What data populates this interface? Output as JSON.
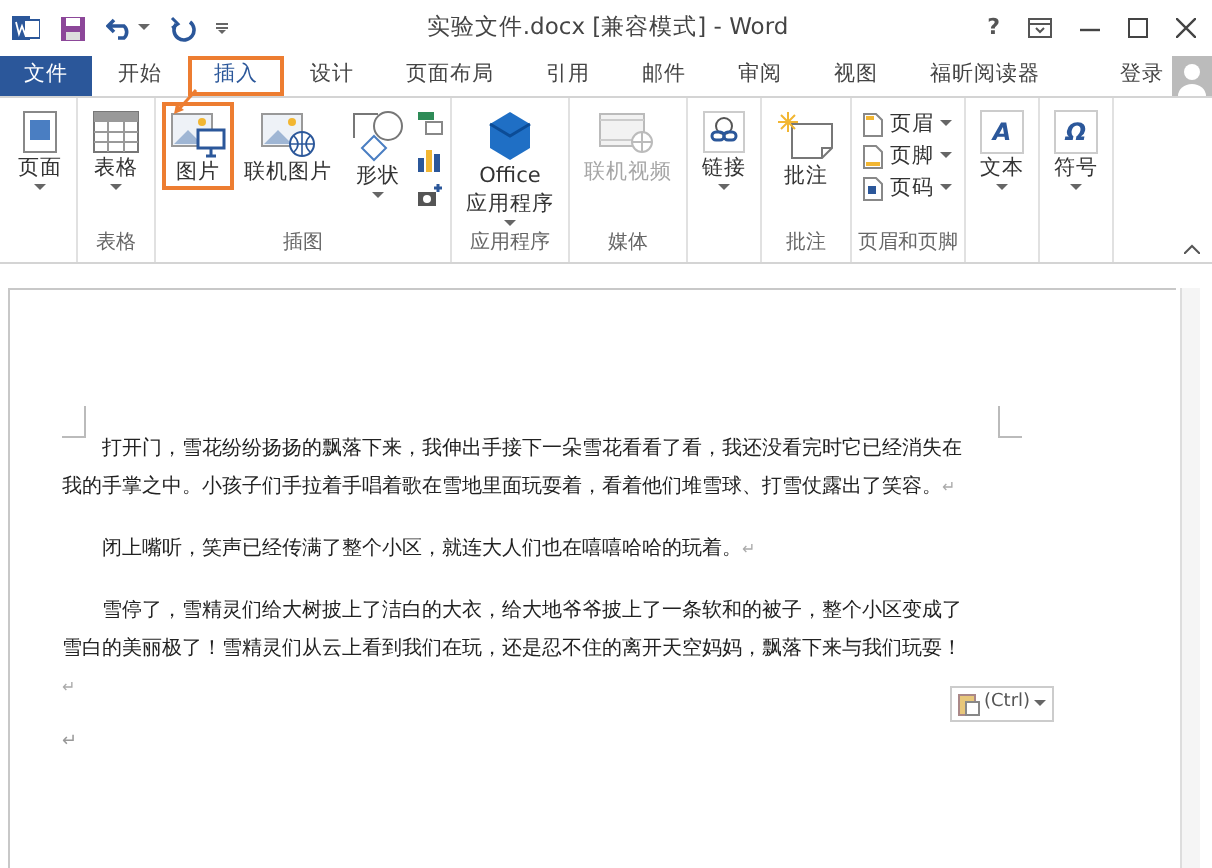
{
  "window": {
    "title": "实验文件.docx [兼容模式] - Word",
    "help": "?"
  },
  "tabs": [
    {
      "label": "文件",
      "kind": "file",
      "selected": false
    },
    {
      "label": "开始",
      "kind": "tab",
      "selected": false
    },
    {
      "label": "插入",
      "kind": "tab",
      "selected": true
    },
    {
      "label": "设计",
      "kind": "tab",
      "selected": false
    },
    {
      "label": "页面布局",
      "kind": "tab",
      "selected": false
    },
    {
      "label": "引用",
      "kind": "tab",
      "selected": false
    },
    {
      "label": "邮件",
      "kind": "tab",
      "selected": false
    },
    {
      "label": "审阅",
      "kind": "tab",
      "selected": false
    },
    {
      "label": "视图",
      "kind": "tab",
      "selected": false
    },
    {
      "label": "福昕阅读器",
      "kind": "tab",
      "selected": false
    }
  ],
  "account": {
    "sign_in": "登录"
  },
  "ribbon": {
    "groups": [
      {
        "items": [
          {
            "kind": "large",
            "lines": [
              "页面"
            ],
            "dropdown": true,
            "highlighted": false,
            "disabled": false
          }
        ]
      },
      {
        "label": "表格",
        "items": [
          {
            "kind": "large",
            "lines": [
              "表格"
            ],
            "dropdown": true,
            "highlighted": false,
            "disabled": false
          }
        ]
      },
      {
        "label": "插图",
        "items": [
          {
            "kind": "large",
            "lines": [
              "图片"
            ],
            "dropdown": false,
            "highlighted": true,
            "disabled": false
          },
          {
            "kind": "large",
            "lines": [
              "联机图片"
            ],
            "dropdown": false,
            "highlighted": false,
            "disabled": false
          },
          {
            "kind": "large",
            "lines": [
              "形状"
            ],
            "dropdown": true,
            "highlighted": false,
            "disabled": false
          },
          {
            "kind": "icon-column"
          }
        ]
      },
      {
        "label": "应用程序",
        "items": [
          {
            "kind": "large",
            "lines": [
              "Office",
              "应用程序"
            ],
            "dropdown": true,
            "highlighted": false,
            "disabled": false
          }
        ]
      },
      {
        "label": "媒体",
        "items": [
          {
            "kind": "large",
            "lines": [
              "联机视频"
            ],
            "dropdown": false,
            "highlighted": false,
            "disabled": true
          }
        ]
      },
      {
        "items": [
          {
            "kind": "large",
            "lines": [
              "链接"
            ],
            "dropdown": true,
            "highlighted": false,
            "disabled": false
          }
        ]
      },
      {
        "label": "批注",
        "items": [
          {
            "kind": "large",
            "lines": [
              "批注"
            ],
            "dropdown": false,
            "highlighted": false,
            "disabled": false
          }
        ]
      },
      {
        "label": "页眉和页脚",
        "items": [
          {
            "kind": "small-list",
            "entries": [
              {
                "label": "页眉"
              },
              {
                "label": "页脚"
              },
              {
                "label": "页码"
              }
            ]
          }
        ]
      },
      {
        "items": [
          {
            "kind": "large",
            "glyph": "A",
            "lines": [
              "文本"
            ],
            "dropdown": true,
            "highlighted": false,
            "disabled": false
          }
        ]
      },
      {
        "items": [
          {
            "kind": "large",
            "glyph": "Ω",
            "lines": [
              "符号"
            ],
            "dropdown": true,
            "highlighted": false,
            "disabled": false
          }
        ]
      }
    ]
  },
  "document": {
    "paragraph_mark": "↵",
    "paragraphs": [
      "打开门，雪花纷纷扬扬的飘落下来，我伸出手接下一朵雪花看看了看，我还没看完时它已经消失在我的手掌之中。小孩子们手拉着手唱着歌在雪地里面玩耍着，看着他们堆雪球、打雪仗露出了笑容。",
      "闭上嘴听，笑声已经传满了整个小区，就连大人们也在嘻嘻哈哈的玩着。",
      "雪停了，雪精灵们给大树披上了洁白的大衣，给大地爷爷披上了一条软和的被子，整个小区变成了雪白的美丽极了！雪精灵们从云上看到我们在玩，还是忍不住的离开天空妈妈，飘落下来与我们玩耍！"
    ]
  },
  "paste_options": {
    "label": "(Ctrl)"
  }
}
